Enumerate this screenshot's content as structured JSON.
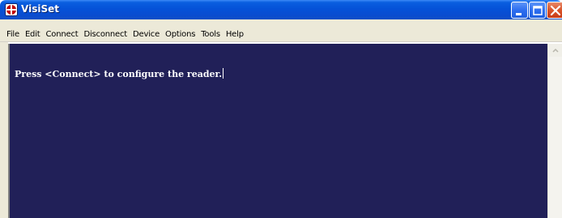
{
  "window": {
    "title": "VisiSet"
  },
  "menu": {
    "items": [
      "File",
      "Edit",
      "Connect",
      "Disconnect",
      "Device",
      "Options",
      "Tools",
      "Help"
    ]
  },
  "terminal": {
    "text": "Press <Connect> to configure the reader."
  },
  "colors": {
    "terminal_bg": "#212058",
    "terminal_fg": "#ffffff",
    "titlebar": "#0552d8"
  }
}
